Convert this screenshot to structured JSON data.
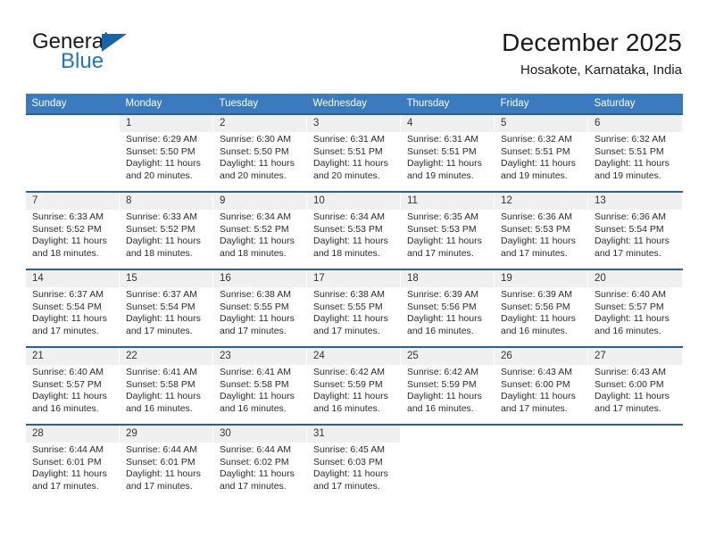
{
  "brand": {
    "name_part1": "General",
    "name_part2": "Blue",
    "logo_icon": "triangle-flag-icon",
    "accent_color": "#1f76c2",
    "triangle_color": "#1565a8"
  },
  "header": {
    "title": "December 2025",
    "subtitle": "Hosakote, Karnataka, India"
  },
  "calendar": {
    "header_color": "#3a7bbf",
    "week_separator_color": "#2a6099",
    "daynum_band_color": "#f0f0f0",
    "weekday_headers": [
      "Sunday",
      "Monday",
      "Tuesday",
      "Wednesday",
      "Thursday",
      "Friday",
      "Saturday"
    ],
    "weeks": [
      [
        {
          "day": "",
          "sunrise": "",
          "sunset": "",
          "daylight_line1": "",
          "daylight_line2": "",
          "empty": true
        },
        {
          "day": "1",
          "sunrise": "Sunrise: 6:29 AM",
          "sunset": "Sunset: 5:50 PM",
          "daylight_line1": "Daylight: 11 hours",
          "daylight_line2": "and 20 minutes."
        },
        {
          "day": "2",
          "sunrise": "Sunrise: 6:30 AM",
          "sunset": "Sunset: 5:50 PM",
          "daylight_line1": "Daylight: 11 hours",
          "daylight_line2": "and 20 minutes."
        },
        {
          "day": "3",
          "sunrise": "Sunrise: 6:31 AM",
          "sunset": "Sunset: 5:51 PM",
          "daylight_line1": "Daylight: 11 hours",
          "daylight_line2": "and 20 minutes."
        },
        {
          "day": "4",
          "sunrise": "Sunrise: 6:31 AM",
          "sunset": "Sunset: 5:51 PM",
          "daylight_line1": "Daylight: 11 hours",
          "daylight_line2": "and 19 minutes."
        },
        {
          "day": "5",
          "sunrise": "Sunrise: 6:32 AM",
          "sunset": "Sunset: 5:51 PM",
          "daylight_line1": "Daylight: 11 hours",
          "daylight_line2": "and 19 minutes."
        },
        {
          "day": "6",
          "sunrise": "Sunrise: 6:32 AM",
          "sunset": "Sunset: 5:51 PM",
          "daylight_line1": "Daylight: 11 hours",
          "daylight_line2": "and 19 minutes."
        }
      ],
      [
        {
          "day": "7",
          "sunrise": "Sunrise: 6:33 AM",
          "sunset": "Sunset: 5:52 PM",
          "daylight_line1": "Daylight: 11 hours",
          "daylight_line2": "and 18 minutes."
        },
        {
          "day": "8",
          "sunrise": "Sunrise: 6:33 AM",
          "sunset": "Sunset: 5:52 PM",
          "daylight_line1": "Daylight: 11 hours",
          "daylight_line2": "and 18 minutes."
        },
        {
          "day": "9",
          "sunrise": "Sunrise: 6:34 AM",
          "sunset": "Sunset: 5:52 PM",
          "daylight_line1": "Daylight: 11 hours",
          "daylight_line2": "and 18 minutes."
        },
        {
          "day": "10",
          "sunrise": "Sunrise: 6:34 AM",
          "sunset": "Sunset: 5:53 PM",
          "daylight_line1": "Daylight: 11 hours",
          "daylight_line2": "and 18 minutes."
        },
        {
          "day": "11",
          "sunrise": "Sunrise: 6:35 AM",
          "sunset": "Sunset: 5:53 PM",
          "daylight_line1": "Daylight: 11 hours",
          "daylight_line2": "and 17 minutes."
        },
        {
          "day": "12",
          "sunrise": "Sunrise: 6:36 AM",
          "sunset": "Sunset: 5:53 PM",
          "daylight_line1": "Daylight: 11 hours",
          "daylight_line2": "and 17 minutes."
        },
        {
          "day": "13",
          "sunrise": "Sunrise: 6:36 AM",
          "sunset": "Sunset: 5:54 PM",
          "daylight_line1": "Daylight: 11 hours",
          "daylight_line2": "and 17 minutes."
        }
      ],
      [
        {
          "day": "14",
          "sunrise": "Sunrise: 6:37 AM",
          "sunset": "Sunset: 5:54 PM",
          "daylight_line1": "Daylight: 11 hours",
          "daylight_line2": "and 17 minutes."
        },
        {
          "day": "15",
          "sunrise": "Sunrise: 6:37 AM",
          "sunset": "Sunset: 5:54 PM",
          "daylight_line1": "Daylight: 11 hours",
          "daylight_line2": "and 17 minutes."
        },
        {
          "day": "16",
          "sunrise": "Sunrise: 6:38 AM",
          "sunset": "Sunset: 5:55 PM",
          "daylight_line1": "Daylight: 11 hours",
          "daylight_line2": "and 17 minutes."
        },
        {
          "day": "17",
          "sunrise": "Sunrise: 6:38 AM",
          "sunset": "Sunset: 5:55 PM",
          "daylight_line1": "Daylight: 11 hours",
          "daylight_line2": "and 17 minutes."
        },
        {
          "day": "18",
          "sunrise": "Sunrise: 6:39 AM",
          "sunset": "Sunset: 5:56 PM",
          "daylight_line1": "Daylight: 11 hours",
          "daylight_line2": "and 16 minutes."
        },
        {
          "day": "19",
          "sunrise": "Sunrise: 6:39 AM",
          "sunset": "Sunset: 5:56 PM",
          "daylight_line1": "Daylight: 11 hours",
          "daylight_line2": "and 16 minutes."
        },
        {
          "day": "20",
          "sunrise": "Sunrise: 6:40 AM",
          "sunset": "Sunset: 5:57 PM",
          "daylight_line1": "Daylight: 11 hours",
          "daylight_line2": "and 16 minutes."
        }
      ],
      [
        {
          "day": "21",
          "sunrise": "Sunrise: 6:40 AM",
          "sunset": "Sunset: 5:57 PM",
          "daylight_line1": "Daylight: 11 hours",
          "daylight_line2": "and 16 minutes."
        },
        {
          "day": "22",
          "sunrise": "Sunrise: 6:41 AM",
          "sunset": "Sunset: 5:58 PM",
          "daylight_line1": "Daylight: 11 hours",
          "daylight_line2": "and 16 minutes."
        },
        {
          "day": "23",
          "sunrise": "Sunrise: 6:41 AM",
          "sunset": "Sunset: 5:58 PM",
          "daylight_line1": "Daylight: 11 hours",
          "daylight_line2": "and 16 minutes."
        },
        {
          "day": "24",
          "sunrise": "Sunrise: 6:42 AM",
          "sunset": "Sunset: 5:59 PM",
          "daylight_line1": "Daylight: 11 hours",
          "daylight_line2": "and 16 minutes."
        },
        {
          "day": "25",
          "sunrise": "Sunrise: 6:42 AM",
          "sunset": "Sunset: 5:59 PM",
          "daylight_line1": "Daylight: 11 hours",
          "daylight_line2": "and 16 minutes."
        },
        {
          "day": "26",
          "sunrise": "Sunrise: 6:43 AM",
          "sunset": "Sunset: 6:00 PM",
          "daylight_line1": "Daylight: 11 hours",
          "daylight_line2": "and 17 minutes."
        },
        {
          "day": "27",
          "sunrise": "Sunrise: 6:43 AM",
          "sunset": "Sunset: 6:00 PM",
          "daylight_line1": "Daylight: 11 hours",
          "daylight_line2": "and 17 minutes."
        }
      ],
      [
        {
          "day": "28",
          "sunrise": "Sunrise: 6:44 AM",
          "sunset": "Sunset: 6:01 PM",
          "daylight_line1": "Daylight: 11 hours",
          "daylight_line2": "and 17 minutes."
        },
        {
          "day": "29",
          "sunrise": "Sunrise: 6:44 AM",
          "sunset": "Sunset: 6:01 PM",
          "daylight_line1": "Daylight: 11 hours",
          "daylight_line2": "and 17 minutes."
        },
        {
          "day": "30",
          "sunrise": "Sunrise: 6:44 AM",
          "sunset": "Sunset: 6:02 PM",
          "daylight_line1": "Daylight: 11 hours",
          "daylight_line2": "and 17 minutes."
        },
        {
          "day": "31",
          "sunrise": "Sunrise: 6:45 AM",
          "sunset": "Sunset: 6:03 PM",
          "daylight_line1": "Daylight: 11 hours",
          "daylight_line2": "and 17 minutes."
        },
        {
          "day": "",
          "sunrise": "",
          "sunset": "",
          "daylight_line1": "",
          "daylight_line2": "",
          "empty": true
        },
        {
          "day": "",
          "sunrise": "",
          "sunset": "",
          "daylight_line1": "",
          "daylight_line2": "",
          "empty": true
        },
        {
          "day": "",
          "sunrise": "",
          "sunset": "",
          "daylight_line1": "",
          "daylight_line2": "",
          "empty": true
        }
      ]
    ]
  }
}
